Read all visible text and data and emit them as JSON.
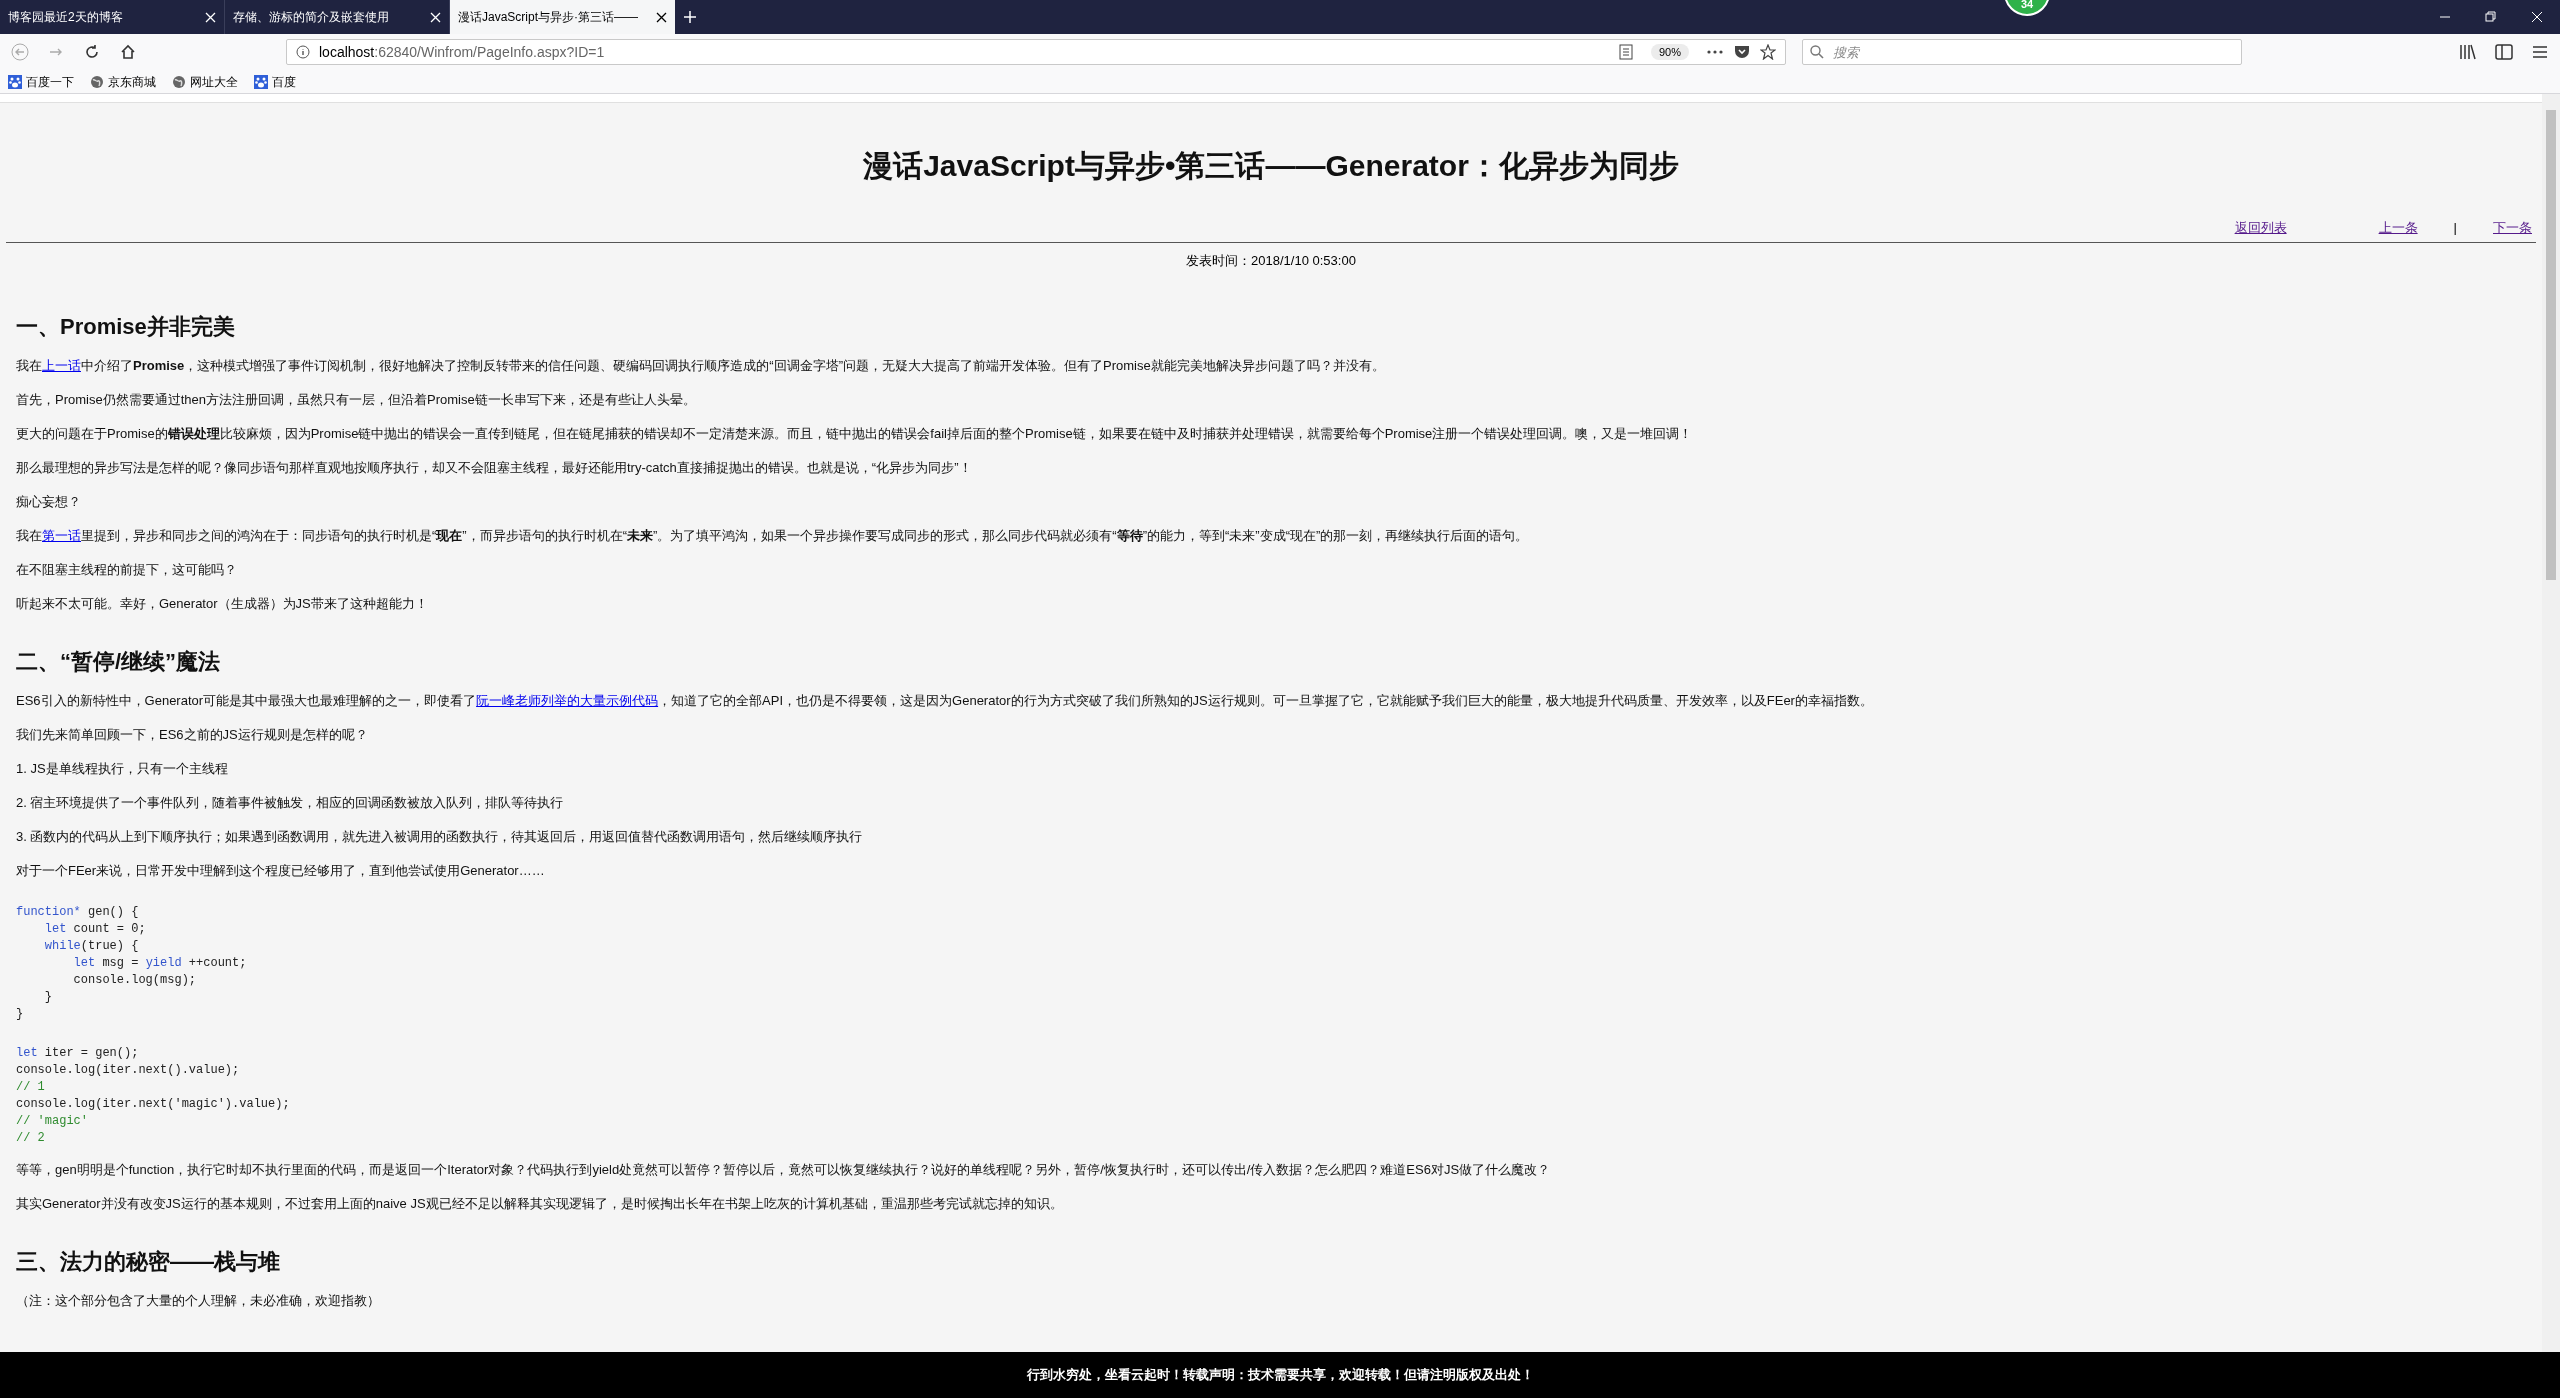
{
  "tabs": [
    {
      "label": "博客园最近2天的博客",
      "selected": false
    },
    {
      "label": "存储、游标的简介及嵌套使用",
      "selected": false
    },
    {
      "label": "漫话JavaScript与异步·第三话——",
      "selected": true
    }
  ],
  "notification_badge": "34",
  "address_bar": {
    "host": "localhost",
    "path": ":62840/Winfrom/PageInfo.aspx?ID=1",
    "zoom": "90%"
  },
  "search": {
    "placeholder": "搜索"
  },
  "bookmarks": [
    {
      "label": "百度一下",
      "kind": "paw"
    },
    {
      "label": "京东商城",
      "kind": "globe"
    },
    {
      "label": "网址大全",
      "kind": "globe"
    },
    {
      "label": "百度",
      "kind": "paw"
    }
  ],
  "article": {
    "title": "漫话JavaScript与异步•第三话——Generator：化异步为同步",
    "nav_links": [
      "返回列表",
      "上一条",
      "下一条"
    ],
    "separator": "|",
    "published": "发表时间：2018/1/10 0:53:00",
    "blocks": [
      {
        "kind": "heading",
        "text": "一、Promise并非完美"
      },
      {
        "kind": "para",
        "parts": [
          {
            "text": "我在"
          },
          {
            "link": "上一话"
          },
          {
            "text": "中介绍了**Promise**，这种模式增强了事件订阅机制，很好地解决了控制反转带来的信任问题、硬编码回调执行顺序造成的“回调金字塔”问题，无疑大大提高了前端开发体验。但有了Promise就能完美地解决异步问题了吗？并没有。"
          }
        ]
      },
      {
        "kind": "para",
        "parts": [
          {
            "text": "首先，Promise仍然需要通过then方法注册回调，虽然只有一层，但沿着Promise链一长串写下来，还是有些让人头晕。"
          }
        ]
      },
      {
        "kind": "para",
        "parts": [
          {
            "text": "更大的问题在于Promise的**错误处理**比较麻烦，因为Promise链中抛出的错误会一直传到链尾，但在链尾捕获的错误却不一定清楚来源。而且，链中抛出的错误会fail掉后面的整个Promise链，如果要在链中及时捕获并处理错误，就需要给每个Promise注册一个错误处理回调。噢，又是一堆回调！"
          }
        ]
      },
      {
        "kind": "para",
        "parts": [
          {
            "text": "那么最理想的异步写法是怎样的呢？像同步语句那样直观地按顺序执行，却又不会阻塞主线程，最好还能用try-catch直接捕捉抛出的错误。也就是说，“化异步为同步”！"
          }
        ]
      },
      {
        "kind": "para",
        "parts": [
          {
            "text": "痴心妄想？"
          }
        ]
      },
      {
        "kind": "para",
        "parts": [
          {
            "text": "我在"
          },
          {
            "link": "第一话"
          },
          {
            "text": "里提到，异步和同步之间的鸿沟在于：同步语句的执行时机是“**现在**”，而异步语句的执行时机在“**未来**”。为了填平鸿沟，如果一个异步操作要写成同步的形式，那么同步代码就必须有“**等待**”的能力，等到“未来”变成“现在”的那一刻，再继续执行后面的语句。"
          }
        ]
      },
      {
        "kind": "para",
        "parts": [
          {
            "text": "在不阻塞主线程的前提下，这可能吗？"
          }
        ]
      },
      {
        "kind": "para",
        "parts": [
          {
            "text": "听起来不太可能。幸好，Generator（生成器）为JS带来了这种超能力！"
          }
        ]
      },
      {
        "kind": "heading",
        "text": "二、“暂停/继续”魔法"
      },
      {
        "kind": "para",
        "parts": [
          {
            "text": "ES6引入的新特性中，Generator可能是其中最强大也最难理解的之一，即使看了"
          },
          {
            "link": "阮一峰老师列举的大量示例代码"
          },
          {
            "text": "，知道了它的全部API，也仍是不得要领，这是因为Generator的行为方式突破了我们所熟知的JS运行规则。可一旦掌握了它，它就能赋予我们巨大的能量，极大地提升代码质量、开发效率，以及FEer的幸福指数。"
          }
        ]
      },
      {
        "kind": "para",
        "parts": [
          {
            "text": "我们先来简单回顾一下，ES6之前的JS运行规则是怎样的呢？"
          }
        ]
      },
      {
        "kind": "para",
        "parts": [
          {
            "text": "1. JS是单线程执行，只有一个主线程"
          }
        ]
      },
      {
        "kind": "para",
        "parts": [
          {
            "text": "2. 宿主环境提供了一个事件队列，随着事件被触发，相应的回调函数被放入队列，排队等待执行"
          }
        ]
      },
      {
        "kind": "para",
        "parts": [
          {
            "text": "3. 函数内的代码从上到下顺序执行；如果遇到函数调用，就先进入被调用的函数执行，待其返回后，用返回值替代函数调用语句，然后继续顺序执行"
          }
        ]
      },
      {
        "kind": "para",
        "parts": [
          {
            "text": "对于一个FEer来说，日常开发中理解到这个程度已经够用了，直到他尝试使用Generator……"
          }
        ]
      },
      {
        "kind": "code",
        "lines": [
          [
            {
              "kind": "keyword",
              "text": "function*"
            },
            {
              "kind": "plain",
              "text": " gen() {"
            }
          ],
          [
            {
              "kind": "keyword",
              "text": "    let"
            },
            {
              "kind": "plain",
              "text": " count = 0;"
            }
          ],
          [
            {
              "kind": "keyword",
              "text": "    while"
            },
            {
              "kind": "plain",
              "text": "(true) {"
            }
          ],
          [
            {
              "kind": "keyword",
              "text": "        let"
            },
            {
              "kind": "plain",
              "text": " msg = "
            },
            {
              "kind": "keyword",
              "text": "yield"
            },
            {
              "kind": "plain",
              "text": " ++count;"
            }
          ],
          [
            {
              "kind": "plain",
              "text": "        console.log(msg);"
            }
          ],
          [
            {
              "kind": "plain",
              "text": "    }"
            }
          ],
          [
            {
              "kind": "plain",
              "text": "}"
            }
          ]
        ]
      },
      {
        "kind": "code",
        "lines": [
          [
            {
              "kind": "keyword",
              "text": "let"
            },
            {
              "kind": "plain",
              "text": " iter = gen();"
            }
          ],
          [
            {
              "kind": "plain",
              "text": "console.log(iter.next().value);"
            }
          ],
          [
            {
              "kind": "comment",
              "text": "// 1"
            }
          ],
          [
            {
              "kind": "plain",
              "text": "console.log(iter.next('magic').value);"
            }
          ],
          [
            {
              "kind": "comment",
              "text": "// 'magic'"
            }
          ],
          [
            {
              "kind": "comment",
              "text": "// 2"
            }
          ]
        ]
      },
      {
        "kind": "para",
        "parts": [
          {
            "text": "等等，gen明明是个function，执行它时却不执行里面的代码，而是返回一个Iterator对象？代码执行到yield处竟然可以暂停？暂停以后，竟然可以恢复继续执行？说好的单线程呢？另外，暂停/恢复执行时，还可以传出/传入数据？怎么肥四？难道ES6对JS做了什么魔改？"
          }
        ]
      },
      {
        "kind": "para",
        "parts": [
          {
            "text": "其实Generator并没有改变JS运行的基本规则，不过套用上面的naive JS观已经不足以解释其实现逻辑了，是时候掏出长年在书架上吃灰的计算机基础，重温那些考完试就忘掉的知识。"
          }
        ]
      },
      {
        "kind": "heading",
        "text": "三、法力的秘密——栈与堆"
      },
      {
        "kind": "para",
        "parts": [
          {
            "text": "（注：这个部分包含了大量的个人理解，未必准确，欢迎指教）"
          }
        ]
      }
    ]
  },
  "footer": "行到水穷处，坐看云起时！转载声明：技术需要共享，欢迎转载！但请注明版权及出处！"
}
